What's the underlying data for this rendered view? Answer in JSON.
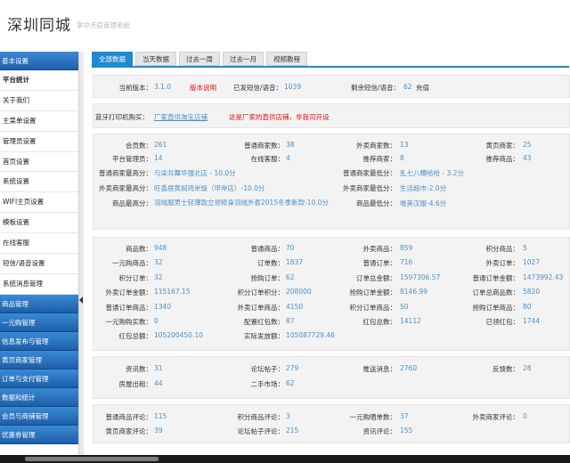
{
  "header": {
    "title": "深圳同城",
    "subtitle": "掌中天辰管理系统"
  },
  "sidebar": {
    "sections": [
      {
        "label": "基本设置",
        "items": [
          "平台统计",
          "关于我们",
          "主菜单设置",
          "管理员设置",
          "首页设置",
          "系统设置",
          "WIFI主页设置",
          "模板设置",
          "在线客服",
          "短信/语音设置",
          "系统消息管理"
        ]
      },
      {
        "label": "商品管理",
        "items": []
      },
      {
        "label": "一元购管理",
        "items": []
      },
      {
        "label": "信息发布与管理",
        "items": []
      },
      {
        "label": "黄页商家管理",
        "items": []
      },
      {
        "label": "订单与支付管理",
        "items": []
      },
      {
        "label": "数据和统计",
        "items": []
      },
      {
        "label": "会员与商铺管理",
        "items": []
      },
      {
        "label": "优惠券管理",
        "items": []
      }
    ]
  },
  "tabs": [
    "全部数据",
    "当天数据",
    "过去一周",
    "过去一月",
    "视频教程"
  ],
  "info": {
    "version_label": "当前版本：",
    "version": "3.1.0",
    "upgrade_link": "版本说明",
    "sent_label": "已发短信/语音：",
    "sent": "1039",
    "remain_label": "剩余短信/语音：",
    "remain": "62",
    "recharge": "充值"
  },
  "printer": {
    "label": "蓝牙打印机购买：",
    "link": "厂家直供淘宝店铺",
    "note": "这是厂家的直供店铺，非我司开设"
  },
  "stats1": {
    "members_label": "会员数：",
    "members": "261",
    "normal_shops_label": "普通商家数：",
    "normal_shops": "38",
    "takeout_shops_label": "外卖商家数：",
    "takeout_shops": "13",
    "yellow_shops_label": "黄页商家：",
    "yellow_shops": "25",
    "admins_label": "平台管理员：",
    "admins": "14",
    "online_label": "在线客服：",
    "online": "4",
    "recommended_shops_label": "推荐商家：",
    "recommended_shops": "8",
    "recommended_items_label": "推荐商品：",
    "recommended_items": "43",
    "normal_high_label": "普通商家最高分：",
    "normal_high": "与柒共舞华强北店 - 10.0分",
    "normal_low_label": "普通商家最低分：",
    "normal_low": "乱七八糟哈哈 - 3.2分",
    "takeout_high_label": "外卖商家最高分：",
    "takeout_high": "旺香居黄焖鸡米饭（甲岸店）-10.0分",
    "takeout_low_label": "外卖商家最低分：",
    "takeout_low": "生活超市-2.0分",
    "item_high_label": "商品最高分：",
    "item_high": "羽绒服男士轻薄款立领修身羽绒外套2015冬季新款-10.0分",
    "item_low_label": "商品最低分：",
    "item_low": "唯美汉服-4.6分"
  },
  "stats2": [
    [
      [
        "商品数：",
        "948"
      ],
      [
        "普通商品：",
        "70"
      ],
      [
        "外卖商品：",
        "859"
      ],
      [
        "积分商品：",
        "5"
      ]
    ],
    [
      [
        "一元购商品：",
        "32"
      ],
      [
        "订单数：",
        "1837"
      ],
      [
        "普通订单：",
        "716"
      ],
      [
        "外卖订单：",
        "1027"
      ]
    ],
    [
      [
        "积分订单：",
        "32"
      ],
      [
        "抢购订单：",
        "62"
      ],
      [
        "订单总金额：",
        "1597306.57"
      ],
      [
        "普通订单金额：",
        "1473992.43"
      ]
    ],
    [
      [
        "外卖订单金额：",
        "115167.15"
      ],
      [
        "积分订单积分：",
        "208000"
      ],
      [
        "抢购订单金额：",
        "8146.99"
      ],
      [
        "订单总商品数：",
        "5820"
      ]
    ],
    [
      [
        "普通订单商品：",
        "1340"
      ],
      [
        "外卖订单商品：",
        "4150"
      ],
      [
        "积分订单商品：",
        "50"
      ],
      [
        "抢购订单商品：",
        "80"
      ]
    ],
    [
      [
        "一元购购买数：",
        "0"
      ],
      [
        "配置红包数：",
        "87"
      ],
      [
        "红包总数：",
        "14112"
      ],
      [
        "已领红包：",
        "1744"
      ]
    ],
    [
      [
        "红包总额：",
        "105200450.10"
      ],
      [
        "实际发放额：",
        "105087729.46"
      ],
      [
        "",
        ""
      ],
      [
        "",
        ""
      ]
    ]
  ],
  "stats3": [
    [
      [
        "资讯数：",
        "31"
      ],
      [
        "论坛帖子：",
        "279"
      ],
      [
        "推送消息：",
        "2760"
      ],
      [
        "反馈数：",
        "28"
      ]
    ],
    [
      [
        "房屋出租：",
        "44"
      ],
      [
        "二手市场：",
        "62"
      ],
      [
        "",
        ""
      ],
      [
        "",
        ""
      ]
    ]
  ],
  "stats4": [
    [
      [
        "普通商品评论：",
        "115"
      ],
      [
        "积分商品评论：",
        "3"
      ],
      [
        "一元购晒单数：",
        "37"
      ],
      [
        "外卖商家评论：",
        "0"
      ]
    ],
    [
      [
        "黄页商家评论：",
        "39"
      ],
      [
        "论坛帖子评论：",
        "215"
      ],
      [
        "资讯评论：",
        "155"
      ],
      [
        "",
        ""
      ]
    ]
  ],
  "colors": {
    "accent": "#1f8ad1",
    "sidebar_head": "#2b74c0",
    "value": "#4a8fc9",
    "alert": "#e01010"
  }
}
